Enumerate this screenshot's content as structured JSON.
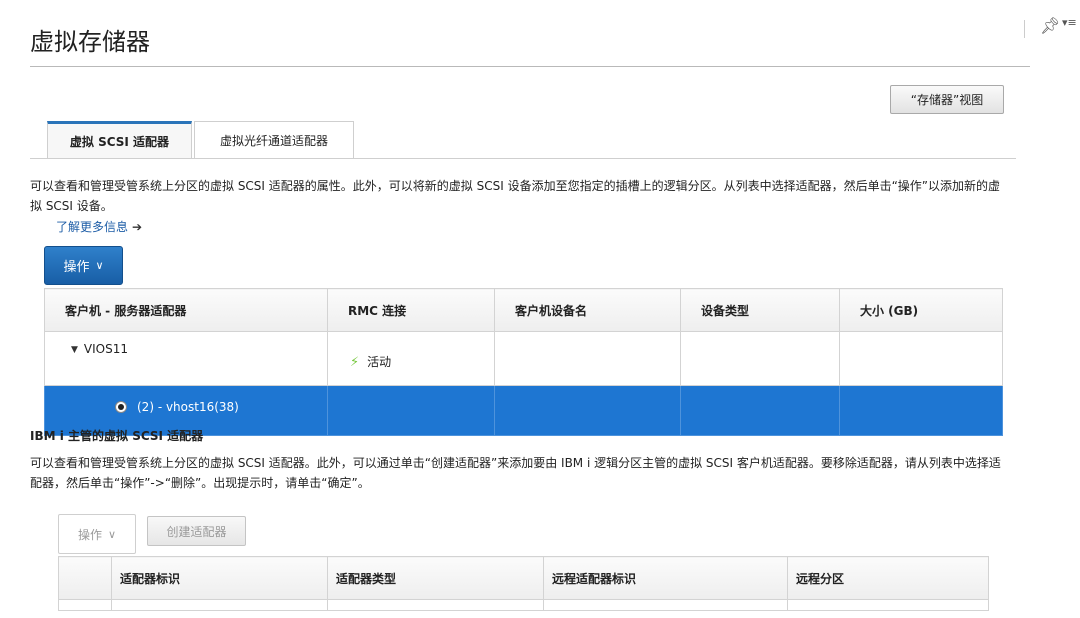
{
  "page": {
    "title": "虚拟存储器"
  },
  "toolbar": {
    "storage_view_label": "“存储器”视图"
  },
  "tabs": [
    {
      "label": "虚拟 SCSI 适配器",
      "active": true
    },
    {
      "label": "虚拟光纤通道适配器",
      "active": false
    }
  ],
  "scsi": {
    "description": "可以查看和管理受管系统上分区的虚拟 SCSI 适配器的属性。此外，可以将新的虚拟 SCSI 设备添加至您指定的插槽上的逻辑分区。从列表中选择适配器，然后单击“操作”以添加新的虚拟 SCSI 设备。",
    "learn_more": "了解更多信息",
    "actions_label": "操作",
    "columns": [
      "客户机 - 服务器适配器",
      "RMC 连接",
      "客户机设备名",
      "设备类型",
      "大小 (GB)"
    ],
    "rows": [
      {
        "adapter": "VIOS11",
        "rmc": "活动",
        "device_name": "",
        "device_type": "",
        "size": "",
        "expanded": true
      },
      {
        "adapter": "(2) - vhost16(38)",
        "rmc": "",
        "device_name": "",
        "device_type": "",
        "size": "",
        "selected": true
      }
    ]
  },
  "ibmi": {
    "heading": "IBM i 主管的虚拟 SCSI 适配器",
    "description": "可以查看和管理受管系统上分区的虚拟 SCSI 适配器。此外，可以通过单击“创建适配器”来添加要由 IBM i 逻辑分区主管的虚拟 SCSI 客户机适配器。要移除适配器，请从列表中选择适配器，然后单击“操作”->“删除”。出现提示时，请单击“确定”。",
    "actions_label": "操作",
    "create_label": "创建适配器",
    "columns": [
      "",
      "适配器标识",
      "适配器类型",
      "远程适配器标识",
      "远程分区"
    ]
  },
  "colors": {
    "accent": "#1e76d2",
    "primary_button": "#185ea6",
    "active_status": "#7ac943"
  },
  "icons": [
    "pin-icon",
    "menu-icon",
    "arrow-right-icon",
    "chevron-down-icon",
    "caret-down-icon",
    "bolt-icon",
    "radio-icon"
  ]
}
